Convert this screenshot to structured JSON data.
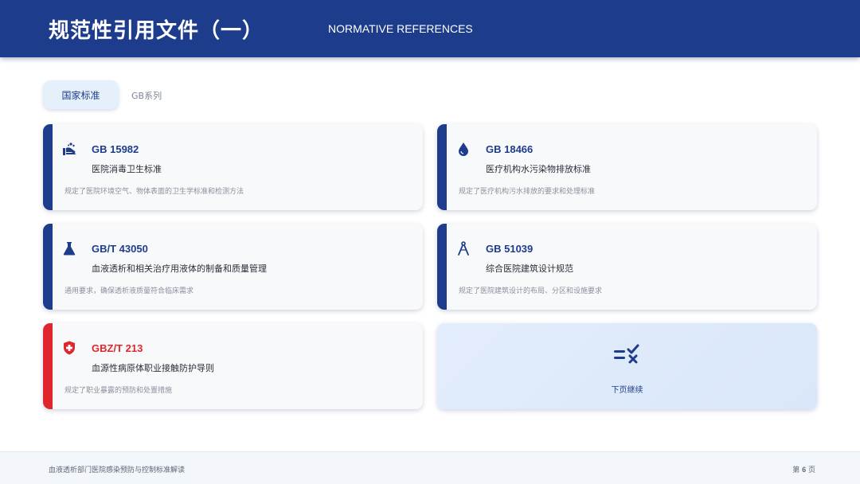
{
  "header": {
    "title": "规范性引用文件（一）",
    "subtitle": "NORMATIVE REFERENCES"
  },
  "tabs": {
    "active": "国家标准",
    "inactive": "GB系列"
  },
  "colors": {
    "primary": "#1e3c8c",
    "danger": "#e0262d",
    "card_bg": "#f8f9fb",
    "next_bg": "#e3edfb"
  },
  "cards": [
    {
      "code": "GB 15982",
      "name": "医院消毒卫生标准",
      "desc": "规定了医院环境空气、物体表面的卫生学标准和检测方法",
      "icon": "hand-wash-icon"
    },
    {
      "code": "GB 18466",
      "name": "医疗机构水污染物排放标准",
      "desc": "规定了医疗机构污水排放的要求和处理标准",
      "icon": "water-drop-icon"
    },
    {
      "code": "GB/T 43050",
      "name": "血液透析和相关治疗用液体的制备和质量管理",
      "desc": "通用要求，确保透析液质量符合临床需求",
      "icon": "flask-icon"
    },
    {
      "code": "GB 51039",
      "name": "综合医院建筑设计规范",
      "desc": "规定了医院建筑设计的布局、分区和设施要求",
      "icon": "compass-icon"
    },
    {
      "code": "GBZ/T 213",
      "name": "血源性病原体职业接触防护导则",
      "desc": "规定了职业暴露的预防和处置措施",
      "icon": "shield-cross-icon"
    }
  ],
  "next_card": {
    "label": "下页继续",
    "icon": "checklist-icon"
  },
  "footer": {
    "left": "血液透析部门医院感染预防与控制标准解读",
    "page_prefix": "第",
    "page_number": "6",
    "page_suffix": "页"
  }
}
